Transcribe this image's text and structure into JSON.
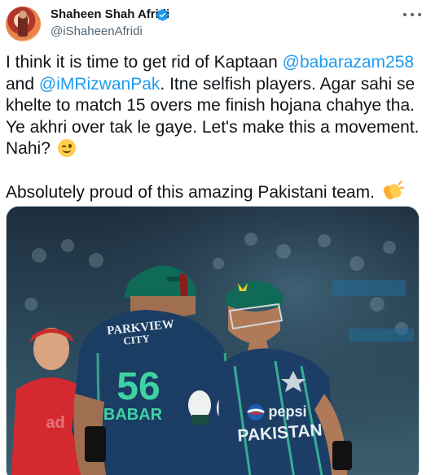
{
  "author": {
    "display_name": "Shaheen Shah Afridi",
    "handle": "@iShaheenAfridi",
    "verified": true
  },
  "tweet": {
    "line1_text": "I think it is time to get rid of Kaptaan ",
    "mention1": "@babarazam258",
    "line2_prefix": "and ",
    "mention2": "@iMRizwanPak",
    "line2_rest": ". Itne selfish players. Agar sahi se",
    "line3": "khelte to match 15 overs me finish hojana chahye tha.",
    "line4": "Ye akhri over tak le gaye. Let's make this a movement.",
    "line5": "Nahi?",
    "line5_emoji": "winking-face-icon",
    "line6": "Absolutely proud of this amazing Pakistani team.",
    "line6_emoji": "clapping-hands-icon"
  },
  "media": {
    "description_icon": "cricket-photo",
    "left_jersey": {
      "sponsor_line1": "PARKVIEW",
      "sponsor_line2": "CITY",
      "number": "56",
      "name": "BABAR"
    },
    "right_jersey": {
      "sponsor": "pepsi",
      "team": "PAKISTAN"
    }
  },
  "colors": {
    "link": "#1d9bf0",
    "text": "#0f1419",
    "secondary": "#536471",
    "verified": "#1d9bf0"
  }
}
